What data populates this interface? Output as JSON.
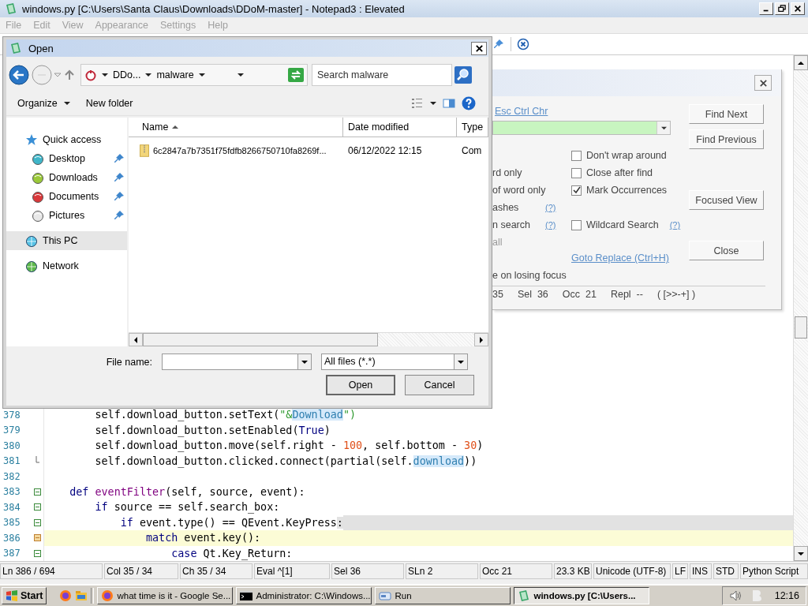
{
  "main_window": {
    "title": "windows.py [C:\\Users\\Santa Claus\\Downloads\\DDoM-master] - Notepad3 : Elevated",
    "menu": [
      {
        "label": "File",
        "disabled": true
      },
      {
        "label": "Edit",
        "disabled": true
      },
      {
        "label": "View",
        "disabled": true
      },
      {
        "label": "Appearance",
        "disabled": true
      },
      {
        "label": "Settings",
        "disabled": true
      },
      {
        "label": "Help",
        "disabled": true
      }
    ]
  },
  "editor": {
    "lines": [
      {
        "number": "378",
        "kind": "plain",
        "current": false,
        "highlighted": false,
        "tokens": [
          {
            "text": "        self.download_button.setText(",
            "kind": "plain"
          },
          {
            "text": "\"&",
            "kind": "string"
          },
          {
            "text": "Download",
            "kind": "occurrence"
          },
          {
            "text": "\")",
            "kind": "string"
          }
        ]
      },
      {
        "number": "379",
        "kind": "plain",
        "current": false,
        "highlighted": false,
        "tokens": [
          {
            "text": "        self.download_button.setEnabled(",
            "kind": "plain"
          },
          {
            "text": "True",
            "kind": "keyword"
          },
          {
            "text": ")",
            "kind": "plain"
          }
        ]
      },
      {
        "number": "380",
        "kind": "plain",
        "current": false,
        "highlighted": false,
        "tokens": [
          {
            "text": "        self.download_button.move(self.right - ",
            "kind": "plain"
          },
          {
            "text": "100",
            "kind": "number"
          },
          {
            "text": ", self.bottom - ",
            "kind": "plain"
          },
          {
            "text": "30",
            "kind": "number"
          },
          {
            "text": ")",
            "kind": "plain"
          }
        ]
      },
      {
        "number": "381",
        "kind": "fold_end",
        "current": false,
        "highlighted": false,
        "tokens": [
          {
            "text": "        self.download_button.clicked.connect(partial(self.",
            "kind": "plain"
          },
          {
            "text": "download",
            "kind": "occurrence"
          },
          {
            "text": "))",
            "kind": "plain"
          }
        ]
      },
      {
        "number": "382",
        "kind": "plain",
        "current": false,
        "highlighted": false
      },
      {
        "number": "383",
        "kind": "fold_start",
        "current": false,
        "highlighted": false,
        "tokens": [
          {
            "text": "    def",
            "kind": "keyword"
          },
          {
            "text": " eventFilter",
            "kind": "defname"
          },
          {
            "text": "(self, source, event):",
            "kind": "plain"
          }
        ]
      },
      {
        "number": "384",
        "kind": "fold_start",
        "current": false,
        "highlighted": false,
        "tokens": [
          {
            "text": "        if",
            "kind": "keyword"
          },
          {
            "text": " source == self.search_box:",
            "kind": "plain"
          }
        ]
      },
      {
        "number": "385",
        "kind": "fold_start",
        "current": false,
        "highlighted": true,
        "tokens": [
          {
            "text": "            if",
            "kind": "keyword"
          },
          {
            "text": " event.type() == QEvent.KeyPress",
            "kind": "plain"
          },
          {
            "text": ":",
            "kind": "selected"
          }
        ]
      },
      {
        "number": "386",
        "kind": "fold_start",
        "current": true,
        "highlighted": false,
        "tokens": [
          {
            "text": "                match",
            "kind": "keyword"
          },
          {
            "text": " event.key():",
            "kind": "plain"
          }
        ]
      },
      {
        "number": "387",
        "kind": "fold_start",
        "current": false,
        "highlighted": false,
        "tokens": [
          {
            "text": "                    case",
            "kind": "keyword"
          },
          {
            "text": " Qt.Key_Return:",
            "kind": "plain"
          }
        ]
      }
    ]
  },
  "find_dialog": {
    "escape_link": "Esc Ctrl Chr",
    "left_options": [
      {
        "label": "rd only",
        "disabled": false
      },
      {
        "label": "of word only",
        "disabled": false
      },
      {
        "label": "ashes",
        "help": "(?)",
        "disabled": false
      },
      {
        "label": "n search",
        "help": "(?)",
        "disabled": false
      },
      {
        "label": "all",
        "disabled": true
      }
    ],
    "checkboxes": [
      {
        "label": "Don't wrap around",
        "checked": false
      },
      {
        "label": "Close after find",
        "checked": false
      },
      {
        "label": "Mark Occurrences",
        "checked": true
      },
      {
        "label": "Wildcard Search",
        "checked": false,
        "help": "(?)"
      }
    ],
    "replace_link": "Goto Replace (Ctrl+H)",
    "buttons": [
      "Find Next",
      "Find Previous",
      "Focused View",
      "Close"
    ],
    "focus_note": "e on losing focus",
    "status": [
      "35",
      "Sel  36",
      "Occ  21",
      "Repl  --",
      "( [>>-+] )"
    ]
  },
  "open_dialog": {
    "title": "Open",
    "crumbs": [
      "DDo...",
      "malware"
    ],
    "search_placeholder": "Search malware",
    "commands": [
      {
        "label": "Organize",
        "dropdown": true
      },
      {
        "label": "New folder",
        "dropdown": false
      }
    ],
    "nav": [
      {
        "label": "Quick access",
        "selected": false,
        "children": [
          {
            "label": "Desktop",
            "pinned": true,
            "selected": false
          },
          {
            "label": "Downloads",
            "pinned": true,
            "selected": false
          },
          {
            "label": "Documents",
            "pinned": true,
            "selected": false
          },
          {
            "label": "Pictures",
            "pinned": true,
            "selected": false
          }
        ]
      },
      {
        "label": "This PC",
        "selected": true
      },
      {
        "label": "Network",
        "selected": false
      }
    ],
    "columns": [
      {
        "label": "Name",
        "sorted": true
      },
      {
        "label": "Date modified",
        "sorted": false
      },
      {
        "label": "Type",
        "sorted": false
      }
    ],
    "files": [
      {
        "name": "6c2847a7b7351f75fdfb8266750710fa8269f...",
        "date": "06/12/2022 12:15",
        "type": "Com"
      }
    ],
    "file_name_label": "File name:",
    "filter": "All files (*.*)",
    "buttons": [
      "Open",
      "Cancel"
    ]
  },
  "status_bar": [
    "Ln 386 / 694",
    "Col 35 / 34",
    "Ch 35 / 34",
    "Eval ^[1]",
    "Sel 36",
    "SLn 2",
    "Occ 21",
    "23.3 KB",
    "Unicode (UTF-8)",
    "LF",
    "INS",
    "STD",
    "Python Script"
  ],
  "taskbar": {
    "start": "Start",
    "tasks": [
      {
        "label": "what time is it - Google Se...",
        "kind": "browser",
        "active": false
      },
      {
        "label": "Administrator: C:\\Windows...",
        "kind": "console",
        "active": false
      },
      {
        "label": "Run",
        "kind": "run",
        "active": false
      },
      {
        "label": "windows.py [C:\\Users...",
        "kind": "editor",
        "active": true
      }
    ],
    "clock": "12:16"
  }
}
